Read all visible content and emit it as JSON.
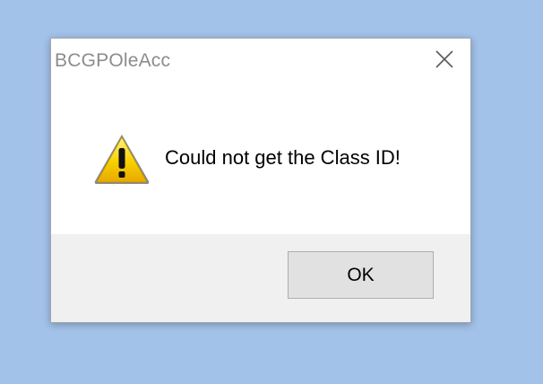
{
  "dialog": {
    "title": "BCGPOleAcc",
    "message": "Could not get the Class ID!",
    "icon": "warning-icon",
    "ok_label": "OK",
    "close_icon": "close-icon"
  },
  "colors": {
    "desktop_background": "#a3c2e9",
    "dialog_background": "#ffffff",
    "footer_background": "#f0f0f0",
    "title_text": "#8c8c8c",
    "warning_yellow": "#f5c400",
    "button_background": "#e1e1e1"
  }
}
